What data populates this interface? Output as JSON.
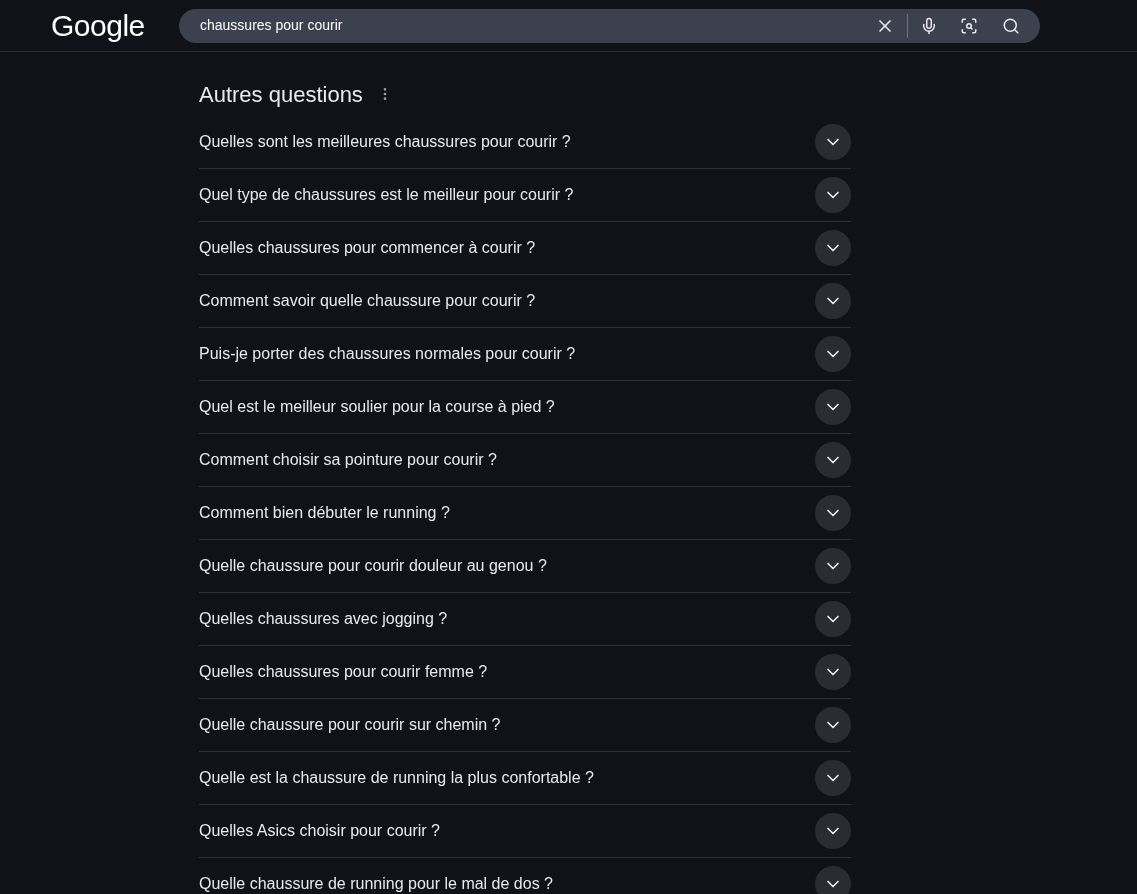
{
  "header": {
    "logo": "Google",
    "search": {
      "value": "chaussures pour courir"
    }
  },
  "section": {
    "title": "Autres questions",
    "questions": [
      {
        "text": "Quelles sont les meilleures chaussures pour courir ?",
        "expanded": false
      },
      {
        "text": "Quel type de chaussures est le meilleur pour courir ?",
        "expanded": false
      },
      {
        "text": "Quelles chaussures pour commencer à courir ?",
        "expanded": false
      },
      {
        "text": "Comment savoir quelle chaussure pour courir ?",
        "expanded": false
      },
      {
        "text": "Puis-je porter des chaussures normales pour courir ?",
        "expanded": false
      },
      {
        "text": "Quel est le meilleur soulier pour la course à pied ?",
        "expanded": false
      },
      {
        "text": "Comment choisir sa pointure pour courir ?",
        "expanded": false
      },
      {
        "text": "Comment bien débuter le running ?",
        "expanded": false
      },
      {
        "text": "Quelle chaussure pour courir douleur au genou ?",
        "expanded": false
      },
      {
        "text": "Quelles chaussures avec jogging ?",
        "expanded": false
      },
      {
        "text": "Quelles chaussures pour courir femme ?",
        "expanded": false
      },
      {
        "text": "Quelle chaussure pour courir sur chemin ?",
        "expanded": false
      },
      {
        "text": "Quelle est la chaussure de running la plus confortable ?",
        "expanded": false
      },
      {
        "text": "Quelles Asics choisir pour courir ?",
        "expanded": false
      },
      {
        "text": "Quelle chaussure de running pour le mal de dos ?",
        "expanded": false
      }
    ]
  }
}
